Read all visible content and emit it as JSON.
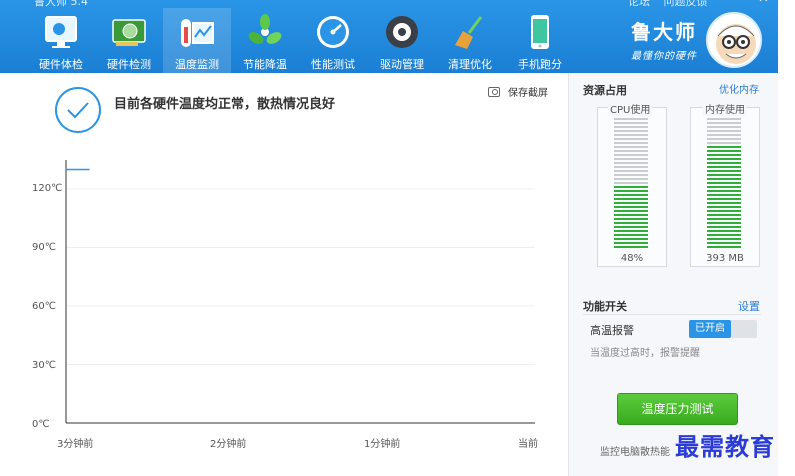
{
  "window": {
    "app_title": "鲁大师 5.4",
    "top_links": [
      "论坛",
      "问题反馈"
    ],
    "minimize_glyph": "—",
    "close_glyph": "✕"
  },
  "nav": {
    "items": [
      {
        "label": "硬件体检",
        "icon": "monitor-check-icon"
      },
      {
        "label": "硬件检测",
        "icon": "graphics-card-icon"
      },
      {
        "label": "温度监测",
        "icon": "thermometer-chart-icon"
      },
      {
        "label": "节能降温",
        "icon": "fan-icon"
      },
      {
        "label": "性能测试",
        "icon": "speedometer-icon"
      },
      {
        "label": "驱动管理",
        "icon": "gear-box-icon"
      },
      {
        "label": "清理优化",
        "icon": "broom-icon"
      },
      {
        "label": "手机跑分",
        "icon": "phone-icon"
      }
    ],
    "active_index": 2
  },
  "brand": {
    "name": "鲁大师",
    "slogan": "最懂你的硬件"
  },
  "main": {
    "status_text": "目前各硬件温度均正常，散热情况良好",
    "screenshot_label": "保存截屏"
  },
  "chart_data": {
    "type": "line",
    "y_ticks": [
      "120℃",
      "90℃",
      "60℃",
      "30℃",
      "0℃"
    ],
    "x_ticks": [
      "3分钟前",
      "2分钟前",
      "1分钟前",
      "当前"
    ],
    "ylim": [
      0,
      130
    ],
    "grid": true,
    "series": [
      {
        "color": "#2a95e6",
        "x": [
          0,
          0.02,
          0.05
        ],
        "values": [
          130,
          130,
          130
        ]
      }
    ]
  },
  "resources": {
    "title": "资源占用",
    "optimize_label": "优化内存",
    "cpu": {
      "label": "CPU使用",
      "value_text": "48%",
      "fraction": 0.48
    },
    "memory": {
      "label": "内存使用",
      "value_text": "393 MB",
      "fraction": 0.78
    }
  },
  "functions": {
    "title": "功能开关",
    "settings_label": "设置",
    "alarm_label": "高温报警",
    "alarm_state": "已开启",
    "alarm_desc": "当温度过高时，报警提醒"
  },
  "footer": {
    "stress_test_label": "温度压力测试",
    "monitor_desc": "监控电脑散热能"
  },
  "watermark": "最需教育",
  "colors": {
    "accent": "#2a95e6",
    "bar_green": "#2fae3a",
    "bar_gray": "#c9cdd2",
    "button_green": "#45b82a"
  }
}
